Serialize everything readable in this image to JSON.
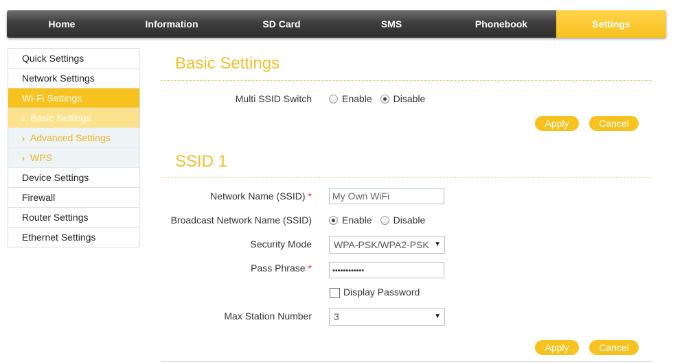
{
  "nav": {
    "tabs": [
      {
        "label": "Home"
      },
      {
        "label": "Information"
      },
      {
        "label": "SD Card"
      },
      {
        "label": "SMS"
      },
      {
        "label": "Phonebook"
      },
      {
        "label": "Settings"
      }
    ]
  },
  "sidebar": {
    "items": [
      {
        "label": "Quick Settings"
      },
      {
        "label": "Network Settings"
      },
      {
        "label": "Wi-Fi Settings"
      },
      {
        "label": "Basic Settings"
      },
      {
        "label": "Advanced Settings"
      },
      {
        "label": "WPS"
      },
      {
        "label": "Device Settings"
      },
      {
        "label": "Firewall"
      },
      {
        "label": "Router Settings"
      },
      {
        "label": "Ethernet Settings"
      }
    ],
    "chevron": "›"
  },
  "basic": {
    "title": "Basic Settings",
    "multi_ssid_label": "Multi SSID Switch",
    "enable_label": "Enable",
    "disable_label": "Disable",
    "selected": "Disable",
    "apply_label": "Apply",
    "cancel_label": "Cancel"
  },
  "ssid1": {
    "title": "SSID 1",
    "network_name_label": "Network Name (SSID)",
    "network_name_value": "My Own WiFi",
    "required_mark": "*",
    "broadcast_label": "Broadcast Network Name (SSID)",
    "enable_label": "Enable",
    "disable_label": "Disable",
    "broadcast_selected": "Enable",
    "security_mode_label": "Security Mode",
    "security_mode_value": "WPA-PSK/WPA2-PSK",
    "pass_phrase_label": "Pass Phrase",
    "pass_phrase_value": "••••••••••••",
    "display_password_label": "Display Password",
    "max_station_label": "Max Station Number",
    "max_station_value": "3",
    "apply_label": "Apply",
    "cancel_label": "Cancel",
    "select_arrow": "▼"
  },
  "colors": {
    "accent": "#f7c21e",
    "nav_dark": "#3e3e3e",
    "sub_bg": "#eef3f5",
    "required": "#d33333"
  }
}
